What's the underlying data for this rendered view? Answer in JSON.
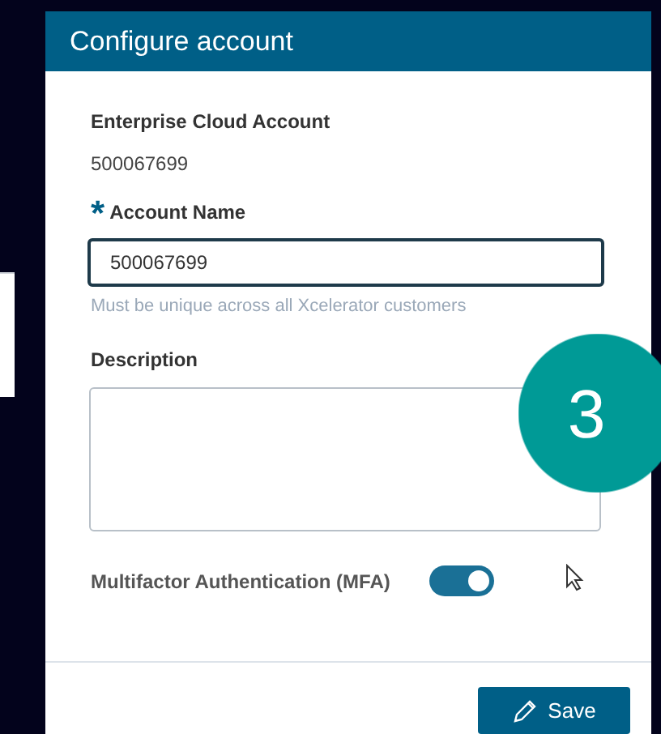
{
  "dialog": {
    "title": "Configure account",
    "account": {
      "label": "Enterprise Cloud Account",
      "value": "500067699"
    },
    "account_name": {
      "marker": "*",
      "label": "Account Name",
      "value": "500067699",
      "hint": "Must be unique across all Xcelerator customers"
    },
    "description": {
      "label": "Description"
    },
    "mfa": {
      "label": "Multifactor Authentication (MFA)",
      "on": true
    },
    "save_button": {
      "label": "Save"
    }
  },
  "step_badge": "3"
}
